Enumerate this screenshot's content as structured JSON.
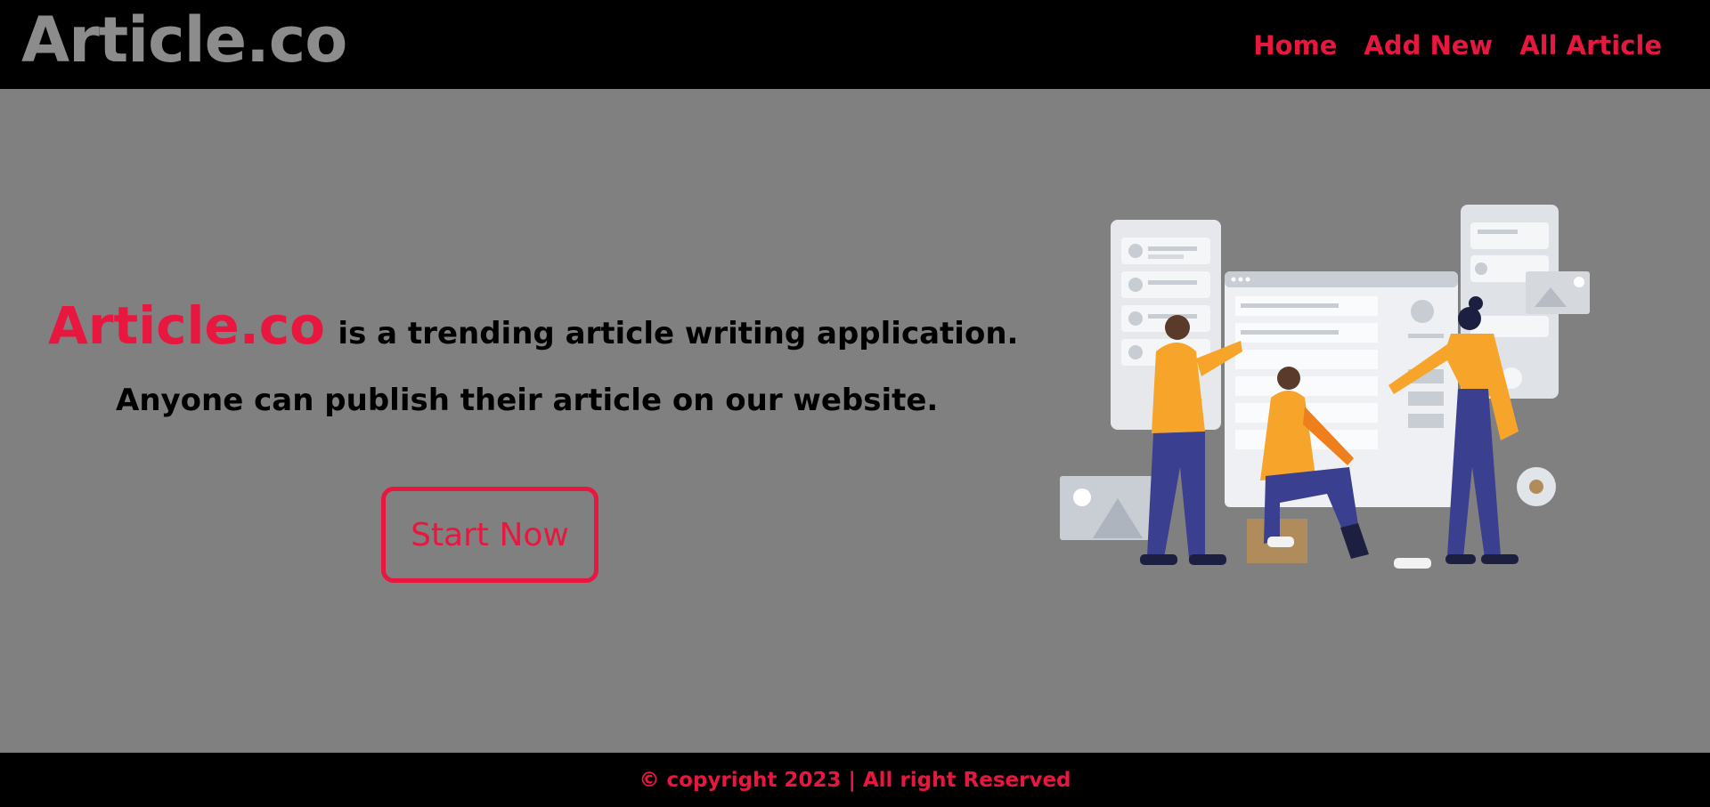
{
  "nav": {
    "brand": "Article.co",
    "links": [
      {
        "label": "Home"
      },
      {
        "label": "Add New"
      },
      {
        "label": "All Article"
      }
    ]
  },
  "hero": {
    "brand": "Article.co",
    "tagline": "is a trending article writing application.",
    "subline": "Anyone can publish their article on our website.",
    "cta_label": "Start Now"
  },
  "footer": {
    "text": "© copyright 2023 | All right Reserved"
  },
  "colors": {
    "accent": "#e8173f",
    "nav_bg": "#000000",
    "page_bg": "#808080",
    "brand_gray": "#8c8c8c"
  },
  "illustration": {
    "icon": "team-collaboration-illustration"
  }
}
